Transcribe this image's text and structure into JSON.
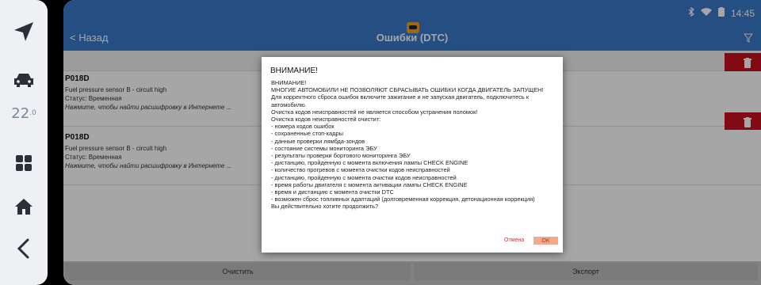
{
  "dock": {
    "temperature": "22",
    "temperature_decimal": ".0",
    "icons": [
      "navigation-icon",
      "car-icon",
      "apps-grid-icon",
      "home-icon",
      "back-arrow-icon"
    ]
  },
  "status_bar": {
    "time": "14:45",
    "icons": [
      "bluetooth-icon",
      "wifi-icon",
      "battery-icon"
    ]
  },
  "header": {
    "back_label": "< Назад",
    "title": "Ошибки (DTC)"
  },
  "dtc_list": [
    {
      "code": "P018D",
      "description": "Fuel pressure sensor B - circuit high",
      "status": "Статус: Временная",
      "link": "Нажмите, чтобы найти расшифровку в Интернете ..."
    },
    {
      "code": "P018D",
      "description": "Fuel pressure sensor B - circuit high",
      "status": "Статус: Временная",
      "link": "Нажмите, чтобы найти расшифровку в Интернете ..."
    }
  ],
  "bottom": {
    "clear_label": "Очистить",
    "export_label": "Экспорт"
  },
  "dialog": {
    "title": "ВНИМАНИЕ!",
    "lines": [
      "ВНИМАНИЕ!",
      "МНОГИЕ АВТОМОБИЛИ НЕ ПОЗВОЛЯЮТ СБРАСЫВАТЬ ОШИБКИ КОГДА ДВИГАТЕЛЬ ЗАПУЩЕН!",
      "Для корректного сброса ошибок включите зажигание и не запуская двигатель, подключитесь к автомобилю.",
      "Очистка кодов неисправностей не является способом устранения поломок!",
      "Очистка кодов неисправностей очистит:",
      "- номера кодов ошибок",
      "- сохраненные стоп-кадры",
      "- данные проверки лямбда-зондов",
      "- состояние системы мониторинга ЭБУ",
      "- результаты проверки бортового мониторинга ЭБУ",
      "- дистанцию, пройденную с момента включения лампы CHECK ENGINE",
      "- количество прогревов с момента очистки кодов неисправностей",
      "- дистанцию, пройденную с момента очистки кодов неисправностей",
      "- время работы двигателя с момента активации лампы CHECK ENGINE",
      "- время и дистанцию с момента очистки DTC",
      "- возможен сброс топливных адаптаций (долговременная коррекция, детонационная коррекция)",
      "Вы действительно хотите продолжить?"
    ],
    "cancel_label": "Отмена",
    "ok_label": "OK"
  },
  "colors": {
    "header_blue": "#3a78c8",
    "delete_red": "#c8101e",
    "ok_salmon": "#f4a98a"
  }
}
